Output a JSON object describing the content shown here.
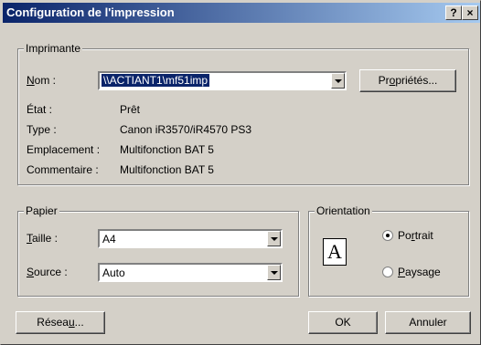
{
  "window": {
    "title": "Configuration de l'impression",
    "help": "?",
    "close": "×"
  },
  "printer": {
    "legend": "Imprimante",
    "name_label_prefix": "",
    "name_label_u": "N",
    "name_label_rest": "om :",
    "name_value": "\\\\ACTIANT1\\mf51imp",
    "properties_u": "o",
    "properties_prefix": "Pr",
    "properties_rest": "priétés...",
    "state_label": "État :",
    "state_value": "Prêt",
    "type_label": "Type :",
    "type_value": "Canon iR3570/iR4570 PS3",
    "location_label": "Emplacement :",
    "location_value": "Multifonction BAT 5",
    "comment_label": "Commentaire :",
    "comment_value": "Multifonction BAT 5"
  },
  "paper": {
    "legend": "Papier",
    "size_u": "T",
    "size_rest": "aille :",
    "size_value": "A4",
    "source_u": "S",
    "source_rest": "ource :",
    "source_value": "Auto"
  },
  "orientation": {
    "legend": "Orientation",
    "icon_letter": "A",
    "portrait_prefix": "Po",
    "portrait_u": "r",
    "portrait_rest": "trait",
    "landscape_u": "P",
    "landscape_rest": "aysage",
    "selected": "portrait"
  },
  "buttons": {
    "network_prefix": "Résea",
    "network_u": "u",
    "network_rest": "...",
    "ok": "OK",
    "cancel": "Annuler"
  }
}
